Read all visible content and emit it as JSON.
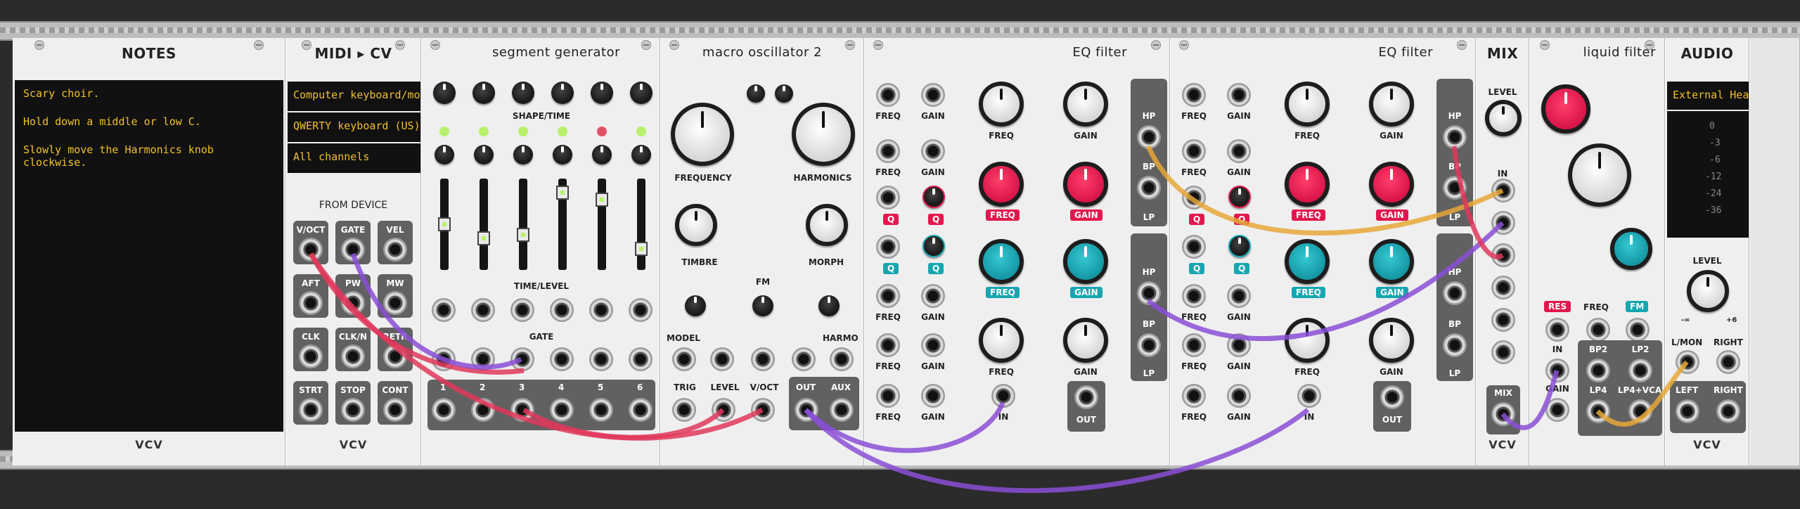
{
  "notes": {
    "title": "NOTES",
    "lines": [
      "Scary choir.",
      "Hold down a middle or low C.",
      "Slowly move the Harmonics knob clockwise."
    ],
    "brand": "VCV"
  },
  "midi": {
    "title": "MIDI ▸ CV",
    "driver": "Computer keyboard/mo",
    "device": "QWERTY keyboard (US)",
    "channel": "All channels",
    "section": "FROM DEVICE",
    "jacks": [
      "V/OCT",
      "GATE",
      "VEL",
      "AFT",
      "PW",
      "MW",
      "CLK",
      "CLK/N",
      "RETR",
      "STRT",
      "STOP",
      "CONT"
    ],
    "brand": "VCV"
  },
  "seg": {
    "title": "segment generator",
    "shape_time": "SHAPE/TIME",
    "time_level": "TIME/LEVEL",
    "gate": "GATE",
    "channels": [
      "1",
      "2",
      "3",
      "4",
      "5",
      "6"
    ]
  },
  "macro": {
    "title": "macro oscillator 2",
    "frequency": "FREQUENCY",
    "harmonics": "HARMONICS",
    "timbre": "TIMBRE",
    "fm": "FM",
    "morph": "MORPH",
    "model": "MODEL",
    "harmo": "HARMO",
    "trig": "TRIG",
    "level": "LEVEL",
    "voct": "V/OCT",
    "out": "OUT",
    "aux": "AUX"
  },
  "eq": {
    "title": "EQ filter",
    "freq": "FREQ",
    "gain": "GAIN",
    "q": "Q",
    "hp": "HP",
    "bp": "BP",
    "lp": "LP",
    "in": "IN",
    "out": "OUT"
  },
  "mix": {
    "title": "MIX",
    "level": "LEVEL",
    "in": "IN",
    "mix": "MIX",
    "brand": "VCV"
  },
  "liquid": {
    "title": "liquid filter",
    "res": "RES",
    "freq": "FREQ",
    "fm": "FM",
    "in": "IN",
    "gain": "GAIN",
    "bp2": "BP2",
    "lp2": "LP2",
    "lp4": "LP4",
    "lp4vca": "LP4+VCA"
  },
  "audio": {
    "title": "AUDIO",
    "device": "External Hea",
    "meter": [
      "0",
      "-3",
      "-6",
      "-12",
      "-24",
      "-36"
    ],
    "level": "LEVEL",
    "min": "-∞",
    "max": "+6",
    "lmon": "L/MON",
    "right": "RIGHT",
    "left": "LEFT",
    "brand": "VCV"
  },
  "colors": {
    "cable_red": "#e0385c",
    "cable_purple": "#8a4fd6",
    "cable_orange": "#e8a738",
    "accent_red": "#e2174d",
    "accent_teal": "#17a6b0"
  }
}
